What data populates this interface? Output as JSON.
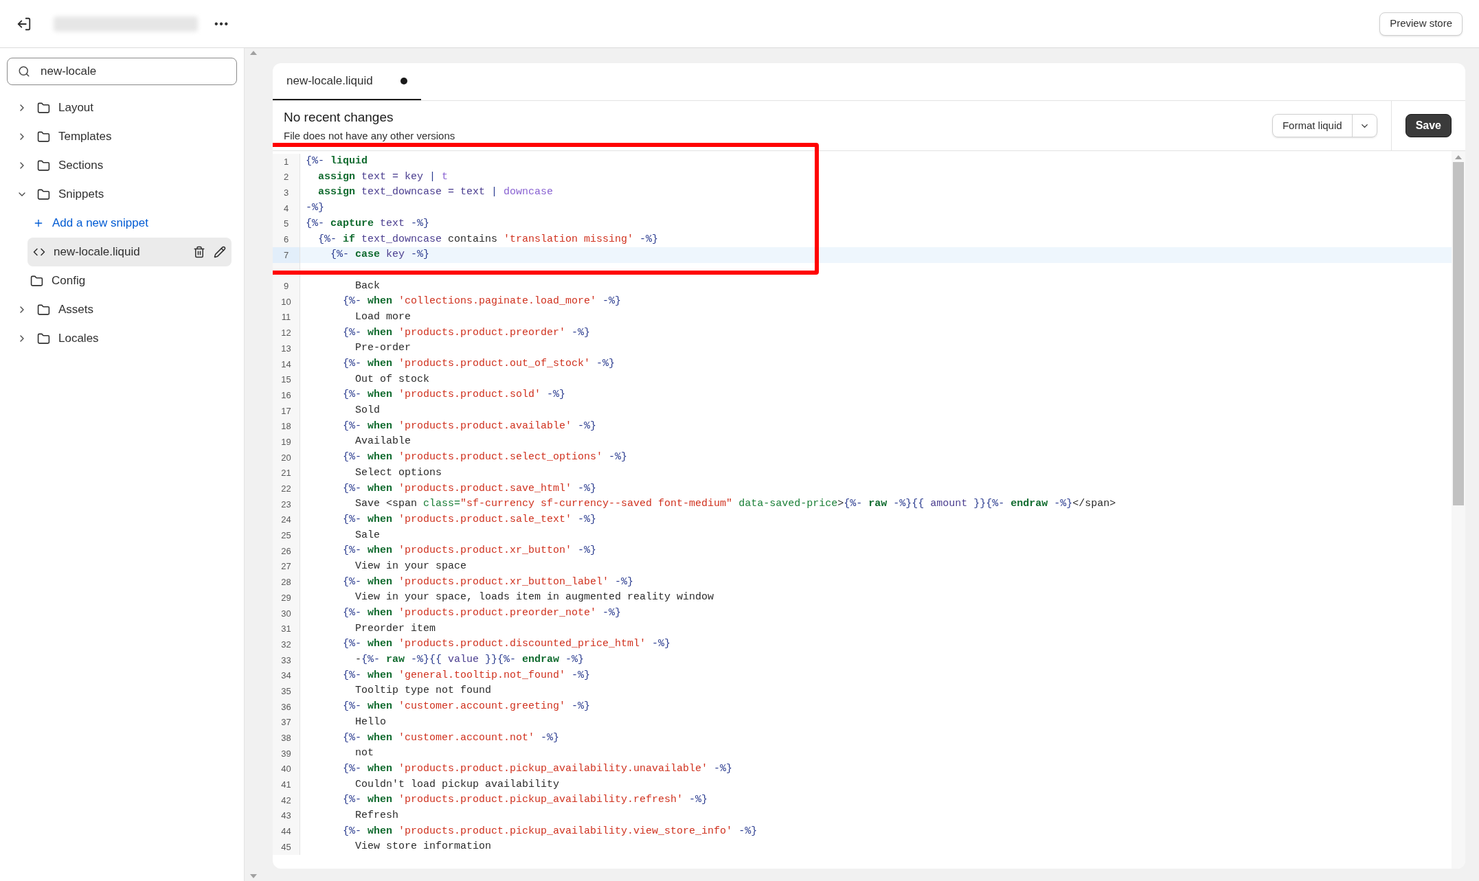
{
  "top_bar": {
    "more_label": "•••",
    "preview_button": "Preview store"
  },
  "sidebar": {
    "search": {
      "value": "new-locale"
    },
    "items": [
      {
        "kind": "folder",
        "label": "Layout",
        "expanded": false
      },
      {
        "kind": "folder",
        "label": "Templates",
        "expanded": false
      },
      {
        "kind": "folder",
        "label": "Sections",
        "expanded": false
      },
      {
        "kind": "folder",
        "label": "Snippets",
        "expanded": true,
        "children": [
          {
            "kind": "add",
            "label": "Add a new snippet"
          },
          {
            "kind": "file",
            "label": "new-locale.liquid",
            "selected": true
          }
        ]
      },
      {
        "kind": "plain_folder",
        "label": "Config"
      },
      {
        "kind": "folder",
        "label": "Assets",
        "expanded": false
      },
      {
        "kind": "folder",
        "label": "Locales",
        "expanded": false
      }
    ]
  },
  "editor": {
    "tabs": [
      {
        "label": "new-locale.liquid",
        "selected": true,
        "unsaved": true
      }
    ],
    "history": {
      "title": "No recent changes",
      "subtitle": "File does not have any other versions"
    },
    "format_button": "Format liquid",
    "save_button": "Save",
    "lines": [
      {
        "n": "1",
        "tokens": [
          {
            "kind": "delim",
            "text": "{%- "
          },
          {
            "kind": "keyword",
            "text": "liquid"
          }
        ]
      },
      {
        "n": "2",
        "tokens": [
          {
            "kind": "keyword",
            "text": "  assign"
          },
          {
            "kind": "variable",
            "text": " text = key "
          },
          {
            "kind": "delim",
            "text": "|"
          },
          {
            "kind": "filter",
            "text": " t"
          }
        ]
      },
      {
        "n": "3",
        "tokens": [
          {
            "kind": "keyword",
            "text": "  assign"
          },
          {
            "kind": "variable",
            "text": " text_downcase = text "
          },
          {
            "kind": "delim",
            "text": "|"
          },
          {
            "kind": "filter",
            "text": " downcase"
          }
        ]
      },
      {
        "n": "4",
        "tokens": [
          {
            "kind": "delim",
            "text": "-%}"
          }
        ]
      },
      {
        "n": "5",
        "tokens": [
          {
            "kind": "delim",
            "text": "{%- "
          },
          {
            "kind": "keyword",
            "text": "capture"
          },
          {
            "kind": "variable",
            "text": " text "
          },
          {
            "kind": "delim",
            "text": "-%}"
          }
        ]
      },
      {
        "n": "6",
        "tokens": [
          {
            "kind": "delim",
            "text": "  {%- "
          },
          {
            "kind": "keyword",
            "text": "if"
          },
          {
            "kind": "variable",
            "text": " text_downcase "
          },
          {
            "kind": "text",
            "text": "contains "
          },
          {
            "kind": "string",
            "text": "'translation missing'"
          },
          {
            "kind": "delim",
            "text": " -%}"
          }
        ]
      },
      {
        "n": "7",
        "current": true,
        "tokens": [
          {
            "kind": "delim",
            "text": "    {%- "
          },
          {
            "kind": "keyword",
            "text": "case"
          },
          {
            "kind": "variable",
            "text": " key "
          },
          {
            "kind": "delim",
            "text": "-%}"
          }
        ]
      },
      {
        "obscured": true
      },
      {
        "n": "9",
        "tokens": [
          {
            "kind": "text",
            "text": "        Back"
          }
        ]
      },
      {
        "n": "10",
        "tokens": [
          {
            "kind": "delim",
            "text": "      {%- "
          },
          {
            "kind": "keyword",
            "text": "when"
          },
          {
            "kind": "string",
            "text": " 'collections.paginate.load_more'"
          },
          {
            "kind": "delim",
            "text": " -%}"
          }
        ]
      },
      {
        "n": "11",
        "tokens": [
          {
            "kind": "text",
            "text": "        Load more"
          }
        ]
      },
      {
        "n": "12",
        "tokens": [
          {
            "kind": "delim",
            "text": "      {%- "
          },
          {
            "kind": "keyword",
            "text": "when"
          },
          {
            "kind": "string",
            "text": " 'products.product.preorder'"
          },
          {
            "kind": "delim",
            "text": " -%}"
          }
        ]
      },
      {
        "n": "13",
        "tokens": [
          {
            "kind": "text",
            "text": "        Pre-order"
          }
        ]
      },
      {
        "n": "14",
        "tokens": [
          {
            "kind": "delim",
            "text": "      {%- "
          },
          {
            "kind": "keyword",
            "text": "when"
          },
          {
            "kind": "string",
            "text": " 'products.product.out_of_stock'"
          },
          {
            "kind": "delim",
            "text": " -%}"
          }
        ]
      },
      {
        "n": "15",
        "tokens": [
          {
            "kind": "text",
            "text": "        Out of stock"
          }
        ]
      },
      {
        "n": "16",
        "tokens": [
          {
            "kind": "delim",
            "text": "      {%- "
          },
          {
            "kind": "keyword",
            "text": "when"
          },
          {
            "kind": "string",
            "text": " 'products.product.sold'"
          },
          {
            "kind": "delim",
            "text": " -%}"
          }
        ]
      },
      {
        "n": "17",
        "tokens": [
          {
            "kind": "text",
            "text": "        Sold"
          }
        ]
      },
      {
        "n": "18",
        "tokens": [
          {
            "kind": "delim",
            "text": "      {%- "
          },
          {
            "kind": "keyword",
            "text": "when"
          },
          {
            "kind": "string",
            "text": " 'products.product.available'"
          },
          {
            "kind": "delim",
            "text": " -%}"
          }
        ]
      },
      {
        "n": "19",
        "tokens": [
          {
            "kind": "text",
            "text": "        Available"
          }
        ]
      },
      {
        "n": "20",
        "tokens": [
          {
            "kind": "delim",
            "text": "      {%- "
          },
          {
            "kind": "keyword",
            "text": "when"
          },
          {
            "kind": "string",
            "text": " 'products.product.select_options'"
          },
          {
            "kind": "delim",
            "text": " -%}"
          }
        ]
      },
      {
        "n": "21",
        "tokens": [
          {
            "kind": "text",
            "text": "        Select options"
          }
        ]
      },
      {
        "n": "22",
        "tokens": [
          {
            "kind": "delim",
            "text": "      {%- "
          },
          {
            "kind": "keyword",
            "text": "when"
          },
          {
            "kind": "string",
            "text": " 'products.product.save_html'"
          },
          {
            "kind": "delim",
            "text": " -%}"
          }
        ]
      },
      {
        "n": "23",
        "tokens": [
          {
            "kind": "text",
            "text": "        Save <span "
          },
          {
            "kind": "attribute",
            "text": "class="
          },
          {
            "kind": "string",
            "text": "\"sf-currency sf-currency--saved font-medium\""
          },
          {
            "kind": "attribute",
            "text": " data-saved-price"
          },
          {
            "kind": "text",
            "text": ">"
          },
          {
            "kind": "delim",
            "text": "{%- "
          },
          {
            "kind": "keyword",
            "text": "raw"
          },
          {
            "kind": "delim",
            "text": " -%}{{ "
          },
          {
            "kind": "variable",
            "text": "amount"
          },
          {
            "kind": "delim",
            "text": " }}{%- "
          },
          {
            "kind": "keyword",
            "text": "endraw"
          },
          {
            "kind": "delim",
            "text": " -%}"
          },
          {
            "kind": "text",
            "text": "</span>"
          }
        ]
      },
      {
        "n": "24",
        "tokens": [
          {
            "kind": "delim",
            "text": "      {%- "
          },
          {
            "kind": "keyword",
            "text": "when"
          },
          {
            "kind": "string",
            "text": " 'products.product.sale_text'"
          },
          {
            "kind": "delim",
            "text": " -%}"
          }
        ]
      },
      {
        "n": "25",
        "tokens": [
          {
            "kind": "text",
            "text": "        Sale"
          }
        ]
      },
      {
        "n": "26",
        "tokens": [
          {
            "kind": "delim",
            "text": "      {%- "
          },
          {
            "kind": "keyword",
            "text": "when"
          },
          {
            "kind": "string",
            "text": " 'products.product.xr_button'"
          },
          {
            "kind": "delim",
            "text": " -%}"
          }
        ]
      },
      {
        "n": "27",
        "tokens": [
          {
            "kind": "text",
            "text": "        View in your space"
          }
        ]
      },
      {
        "n": "28",
        "tokens": [
          {
            "kind": "delim",
            "text": "      {%- "
          },
          {
            "kind": "keyword",
            "text": "when"
          },
          {
            "kind": "string",
            "text": " 'products.product.xr_button_label'"
          },
          {
            "kind": "delim",
            "text": " -%}"
          }
        ]
      },
      {
        "n": "29",
        "tokens": [
          {
            "kind": "text",
            "text": "        View in your space, loads item in augmented reality window"
          }
        ]
      },
      {
        "n": "30",
        "tokens": [
          {
            "kind": "delim",
            "text": "      {%- "
          },
          {
            "kind": "keyword",
            "text": "when"
          },
          {
            "kind": "string",
            "text": " 'products.product.preorder_note'"
          },
          {
            "kind": "delim",
            "text": " -%}"
          }
        ]
      },
      {
        "n": "31",
        "tokens": [
          {
            "kind": "text",
            "text": "        Preorder item"
          }
        ]
      },
      {
        "n": "32",
        "tokens": [
          {
            "kind": "delim",
            "text": "      {%- "
          },
          {
            "kind": "keyword",
            "text": "when"
          },
          {
            "kind": "string",
            "text": " 'products.product.discounted_price_html'"
          },
          {
            "kind": "delim",
            "text": " -%}"
          }
        ]
      },
      {
        "n": "33",
        "tokens": [
          {
            "kind": "text",
            "text": "        -"
          },
          {
            "kind": "delim",
            "text": "{%- "
          },
          {
            "kind": "keyword",
            "text": "raw"
          },
          {
            "kind": "delim",
            "text": " -%}{{ "
          },
          {
            "kind": "variable",
            "text": "value"
          },
          {
            "kind": "delim",
            "text": " }}{%- "
          },
          {
            "kind": "keyword",
            "text": "endraw"
          },
          {
            "kind": "delim",
            "text": " -%}"
          }
        ]
      },
      {
        "n": "34",
        "tokens": [
          {
            "kind": "delim",
            "text": "      {%- "
          },
          {
            "kind": "keyword",
            "text": "when"
          },
          {
            "kind": "string",
            "text": " 'general.tooltip.not_found'"
          },
          {
            "kind": "delim",
            "text": " -%}"
          }
        ]
      },
      {
        "n": "35",
        "tokens": [
          {
            "kind": "text",
            "text": "        Tooltip type not found"
          }
        ]
      },
      {
        "n": "36",
        "tokens": [
          {
            "kind": "delim",
            "text": "      {%- "
          },
          {
            "kind": "keyword",
            "text": "when"
          },
          {
            "kind": "string",
            "text": " 'customer.account.greeting'"
          },
          {
            "kind": "delim",
            "text": " -%}"
          }
        ]
      },
      {
        "n": "37",
        "tokens": [
          {
            "kind": "text",
            "text": "        Hello"
          }
        ]
      },
      {
        "n": "38",
        "tokens": [
          {
            "kind": "delim",
            "text": "      {%- "
          },
          {
            "kind": "keyword",
            "text": "when"
          },
          {
            "kind": "string",
            "text": " 'customer.account.not'"
          },
          {
            "kind": "delim",
            "text": " -%}"
          }
        ]
      },
      {
        "n": "39",
        "tokens": [
          {
            "kind": "text",
            "text": "        not"
          }
        ]
      },
      {
        "n": "40",
        "tokens": [
          {
            "kind": "delim",
            "text": "      {%- "
          },
          {
            "kind": "keyword",
            "text": "when"
          },
          {
            "kind": "string",
            "text": " 'products.product.pickup_availability.unavailable'"
          },
          {
            "kind": "delim",
            "text": " -%}"
          }
        ]
      },
      {
        "n": "41",
        "tokens": [
          {
            "kind": "text",
            "text": "        Couldn't load pickup availability"
          }
        ]
      },
      {
        "n": "42",
        "tokens": [
          {
            "kind": "delim",
            "text": "      {%- "
          },
          {
            "kind": "keyword",
            "text": "when"
          },
          {
            "kind": "string",
            "text": " 'products.product.pickup_availability.refresh'"
          },
          {
            "kind": "delim",
            "text": " -%}"
          }
        ]
      },
      {
        "n": "43",
        "tokens": [
          {
            "kind": "text",
            "text": "        Refresh"
          }
        ]
      },
      {
        "n": "44",
        "tokens": [
          {
            "kind": "delim",
            "text": "      {%- "
          },
          {
            "kind": "keyword",
            "text": "when"
          },
          {
            "kind": "string",
            "text": " 'products.product.pickup_availability.view_store_info'"
          },
          {
            "kind": "delim",
            "text": " -%}"
          }
        ]
      },
      {
        "n": "45",
        "tokens": [
          {
            "kind": "text",
            "text": "        View store information"
          }
        ]
      }
    ]
  }
}
